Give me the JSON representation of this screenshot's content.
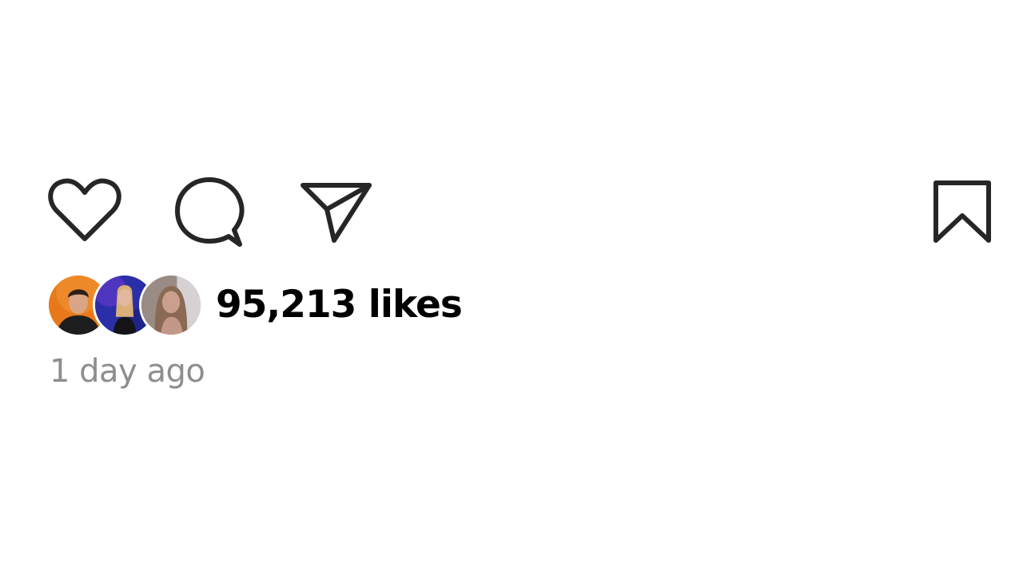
{
  "post": {
    "actions": {
      "like_icon": "heart-outline-icon",
      "comment_icon": "comment-bubble-icon",
      "share_icon": "paper-plane-icon",
      "save_icon": "bookmark-outline-icon"
    },
    "likes": {
      "count_text": "95,213 likes"
    },
    "timestamp": "1 day ago"
  },
  "colors": {
    "icon_stroke": "#262626",
    "text_primary": "#000000",
    "text_secondary": "#8e8e8e",
    "background": "#ffffff"
  }
}
